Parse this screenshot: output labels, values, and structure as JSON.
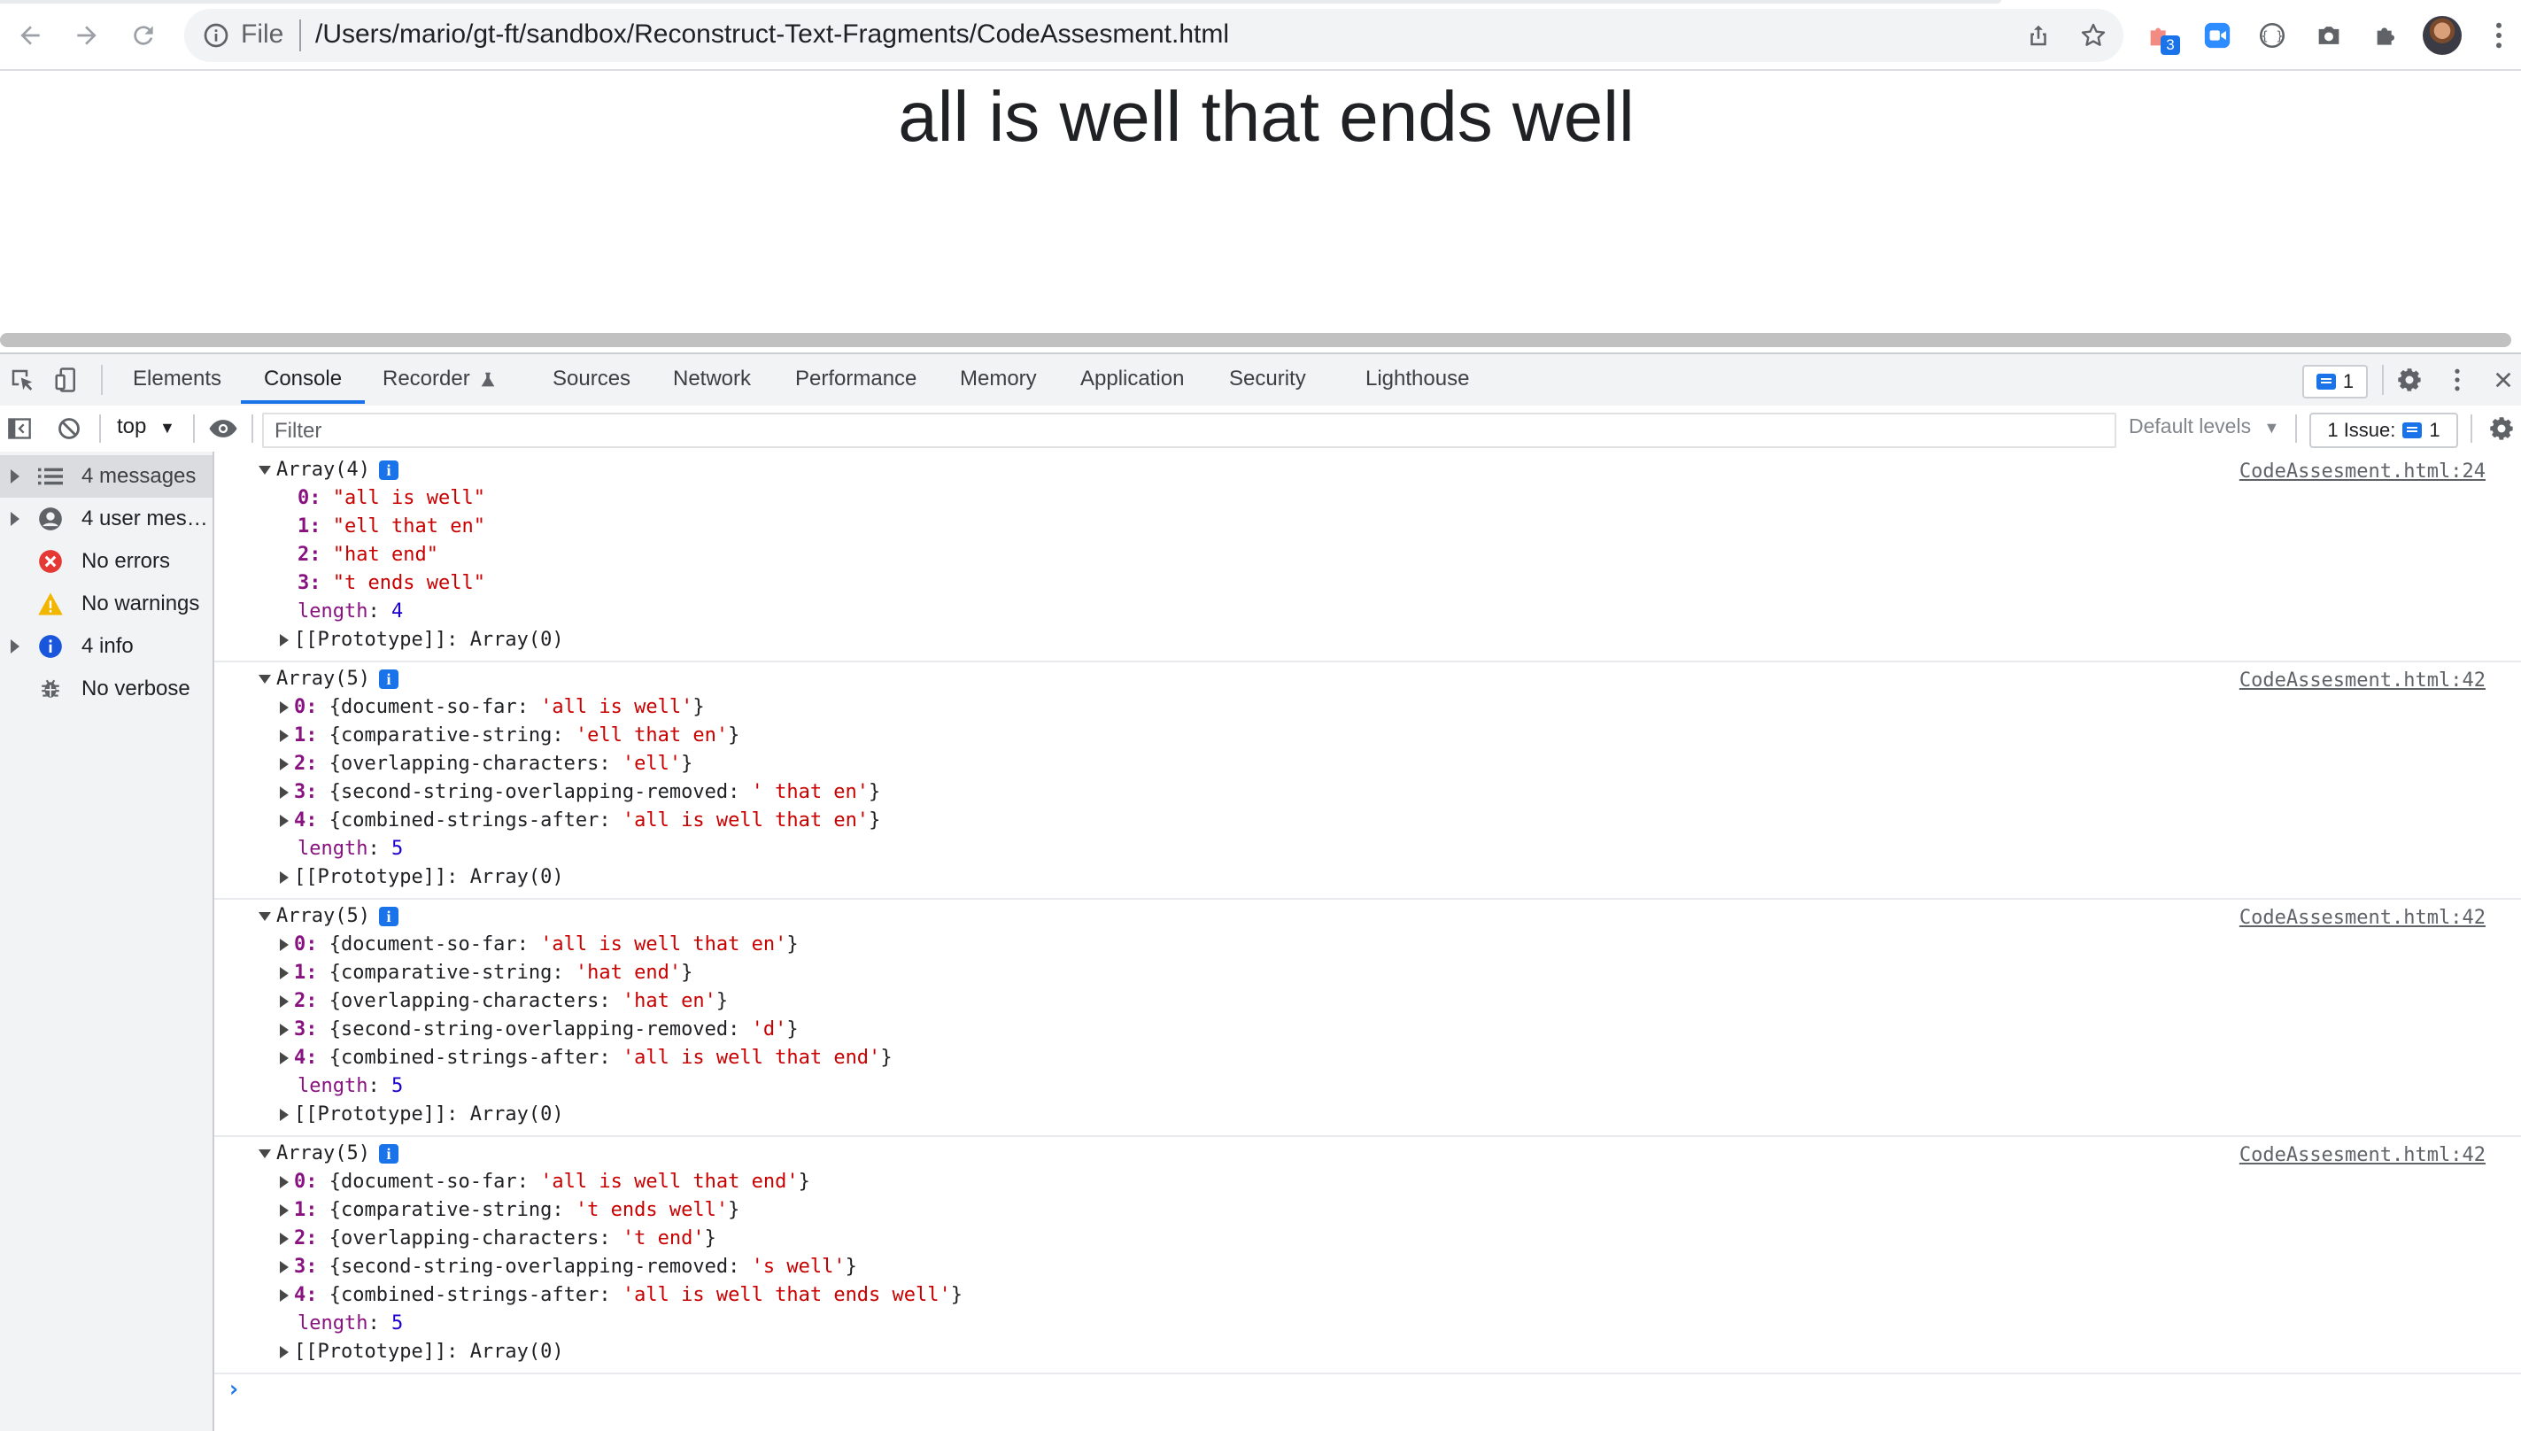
{
  "browser": {
    "url_scheme": "File",
    "url_path": "/Users/mario/gt-ft/sandbox/Reconstruct-Text-Fragments/CodeAssesment.html",
    "extension_badge": "3"
  },
  "page": {
    "heading": "all is well that ends well"
  },
  "devtools": {
    "tabs": [
      "Elements",
      "Console",
      "Recorder",
      "Sources",
      "Network",
      "Performance",
      "Memory",
      "Application",
      "Security",
      "Lighthouse"
    ],
    "active_tab": "Console",
    "message_count": "1",
    "context": "top",
    "filter_placeholder": "Filter",
    "default_levels": "Default levels",
    "issues_label": "1 Issue:",
    "issues_count": "1"
  },
  "sidebar": {
    "items": [
      {
        "label": "4 messages",
        "icon": "list-icon",
        "expandable": true,
        "selected": true
      },
      {
        "label": "4 user mes…",
        "icon": "user-icon",
        "expandable": true,
        "selected": false
      },
      {
        "label": "No errors",
        "icon": "error-icon",
        "expandable": false,
        "selected": false
      },
      {
        "label": "No warnings",
        "icon": "warning-icon",
        "expandable": false,
        "selected": false
      },
      {
        "label": "4 info",
        "icon": "info-icon",
        "expandable": true,
        "selected": false
      },
      {
        "label": "No verbose",
        "icon": "bug-icon",
        "expandable": false,
        "selected": false
      }
    ]
  },
  "console": {
    "entries": [
      {
        "header": "Array(4)",
        "source": "CodeAssesment.html:24",
        "items": [
          {
            "index": "0",
            "value": "\"all is well\""
          },
          {
            "index": "1",
            "value": "\"ell that en\""
          },
          {
            "index": "2",
            "value": "\"hat end\""
          },
          {
            "index": "3",
            "value": "\"t ends well\""
          }
        ],
        "length": "4",
        "prototype": "Array(0)"
      },
      {
        "header": "Array(5)",
        "source": "CodeAssesment.html:42",
        "objects": [
          {
            "index": "0",
            "key": "document-so-far",
            "value": "'all is well'"
          },
          {
            "index": "1",
            "key": "comparative-string",
            "value": "'ell that en'"
          },
          {
            "index": "2",
            "key": "overlapping-characters",
            "value": "'ell'"
          },
          {
            "index": "3",
            "key": "second-string-overlapping-removed",
            "value": "' that en'"
          },
          {
            "index": "4",
            "key": "combined-strings-after",
            "value": "'all is well that en'"
          }
        ],
        "length": "5",
        "prototype": "Array(0)"
      },
      {
        "header": "Array(5)",
        "source": "CodeAssesment.html:42",
        "objects": [
          {
            "index": "0",
            "key": "document-so-far",
            "value": "'all is well that en'"
          },
          {
            "index": "1",
            "key": "comparative-string",
            "value": "'hat end'"
          },
          {
            "index": "2",
            "key": "overlapping-characters",
            "value": "'hat en'"
          },
          {
            "index": "3",
            "key": "second-string-overlapping-removed",
            "value": "'d'"
          },
          {
            "index": "4",
            "key": "combined-strings-after",
            "value": "'all is well that end'"
          }
        ],
        "length": "5",
        "prototype": "Array(0)"
      },
      {
        "header": "Array(5)",
        "source": "CodeAssesment.html:42",
        "objects": [
          {
            "index": "0",
            "key": "document-so-far",
            "value": "'all is well that end'"
          },
          {
            "index": "1",
            "key": "comparative-string",
            "value": "'t ends well'"
          },
          {
            "index": "2",
            "key": "overlapping-characters",
            "value": "'t end'"
          },
          {
            "index": "3",
            "key": "second-string-overlapping-removed",
            "value": "'s well'"
          },
          {
            "index": "4",
            "key": "combined-strings-after",
            "value": "'all is well that ends well'"
          }
        ],
        "length": "5",
        "prototype": "Array(0)"
      }
    ],
    "prompt": "›"
  }
}
